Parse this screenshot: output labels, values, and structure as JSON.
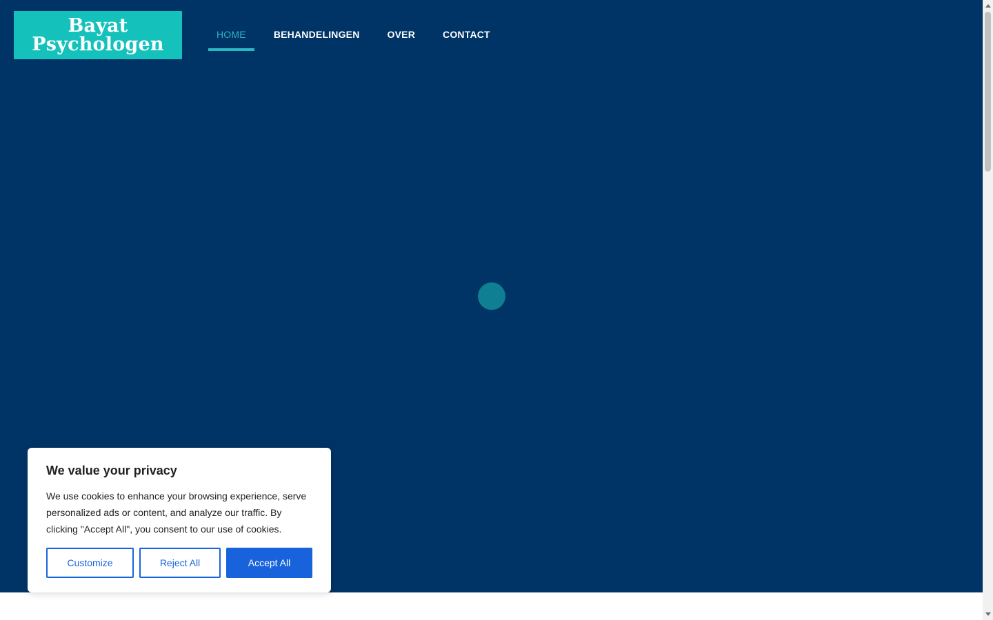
{
  "header": {
    "logo_line1": "Bayat",
    "logo_line2": "Psychologen",
    "nav": [
      {
        "label": "HOME",
        "active": true
      },
      {
        "label": "BEHANDELINGEN",
        "active": false
      },
      {
        "label": "OVER",
        "active": false
      },
      {
        "label": "CONTACT",
        "active": false
      }
    ]
  },
  "cookie_banner": {
    "title": "We value your privacy",
    "body": "We use cookies to enhance your browsing experience, serve personalized ads or content, and analyze our traffic. By clicking \"Accept All\", you consent to our use of cookies.",
    "customize_label": "Customize",
    "reject_label": "Reject All",
    "accept_label": "Accept All"
  },
  "colors": {
    "hero_background": "#003366",
    "brand_teal": "#14c2bb",
    "nav_active": "#2bb6c4",
    "loader": "#0f7f93",
    "cookie_button_blue": "#1863dc"
  }
}
